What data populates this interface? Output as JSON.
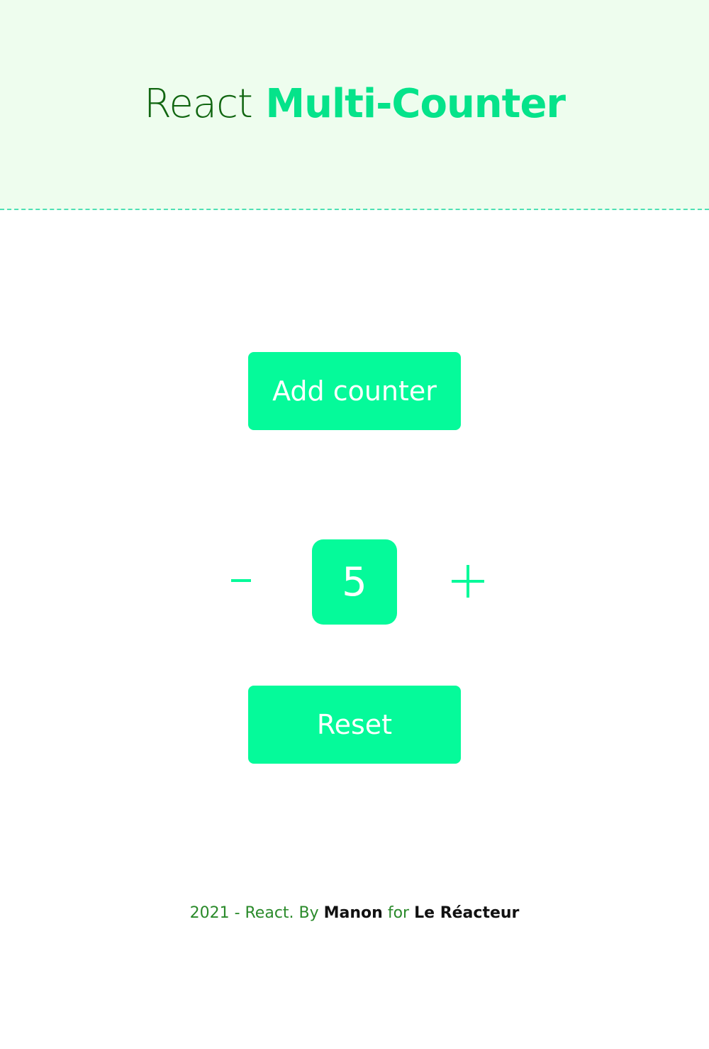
{
  "header": {
    "title_prefix": "React",
    "title_highlight": "Multi-Counter"
  },
  "actions": {
    "add_counter_label": "Add counter"
  },
  "counter": {
    "decrement_icon": "minus-icon",
    "increment_icon": "plus-icon",
    "value": "5",
    "reset_label": "Reset"
  },
  "footer": {
    "year_text": "2021 - React. By",
    "author": "Manon",
    "for_text": "for",
    "organization": "Le Réacteur"
  },
  "colors": {
    "accent": "#05fa9a",
    "header_bg": "#eefdee",
    "title_dark_green": "#116611",
    "title_bright_green": "#05e38a",
    "dashed_border": "#4fe0b4"
  }
}
